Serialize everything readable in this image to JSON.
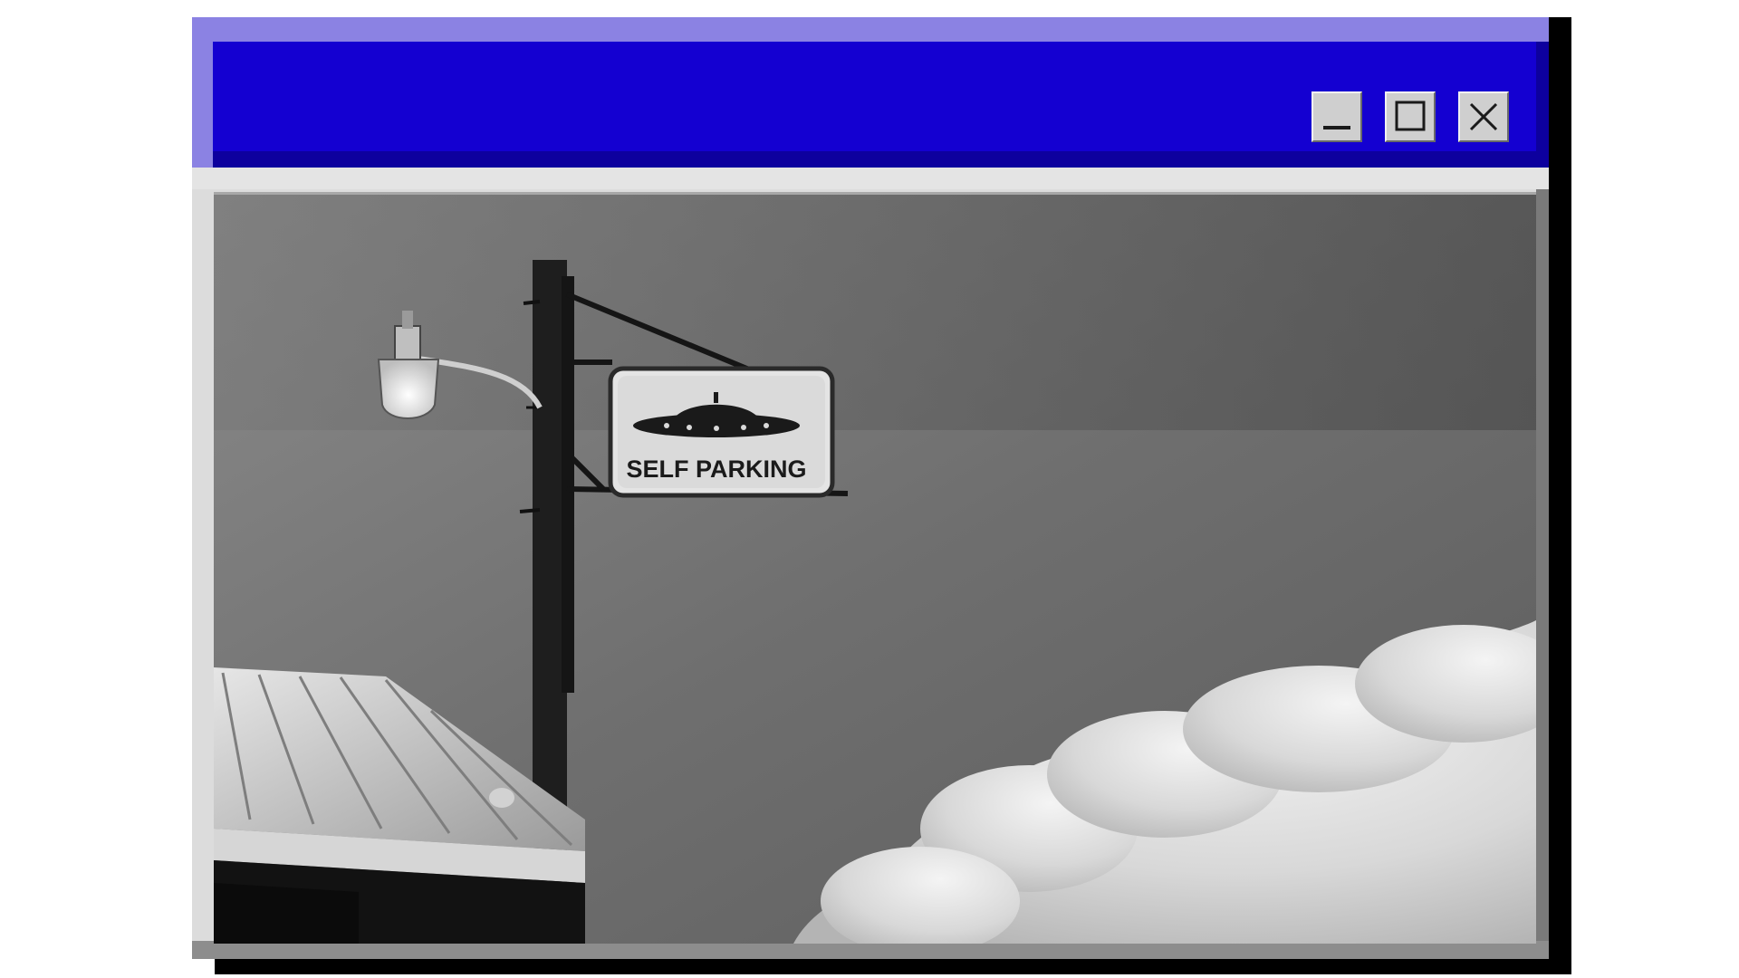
{
  "window": {
    "title": "",
    "controls": {
      "minimize_icon": "minimize-icon",
      "maximize_icon": "maximize-icon",
      "close_icon": "close-icon"
    }
  },
  "photo": {
    "sign_text": "SELF PARKING",
    "sign_icon": "ufo-icon"
  },
  "colors": {
    "titlebar": "#1400d1",
    "titlebar_border": "#8b82e3",
    "window_body": "#dcdcdc"
  }
}
